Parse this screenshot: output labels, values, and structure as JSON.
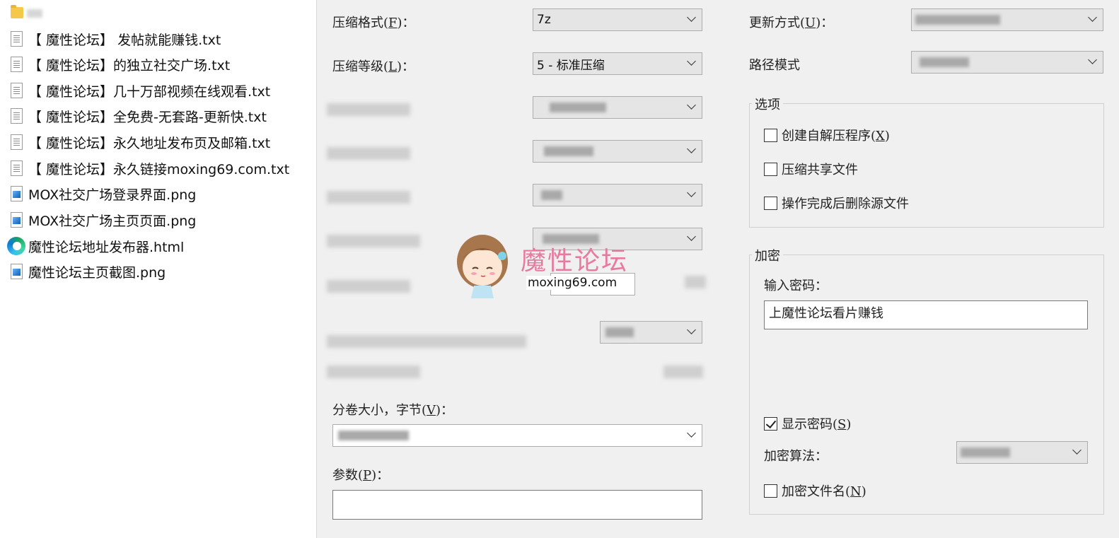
{
  "file_list": {
    "folder_label": "",
    "files": [
      {
        "name": "【 魔性论坛】 发帖就能赚钱.txt",
        "icon": "text-file-icon"
      },
      {
        "name": "【 魔性论坛】的独立社交广场.txt",
        "icon": "text-file-icon"
      },
      {
        "name": "【 魔性论坛】几十万部视频在线观看.txt",
        "icon": "text-file-icon"
      },
      {
        "name": "【 魔性论坛】全免费-无套路-更新快.txt",
        "icon": "text-file-icon"
      },
      {
        "name": "【 魔性论坛】永久地址发布页及邮箱.txt",
        "icon": "text-file-icon"
      },
      {
        "name": "【 魔性论坛】永久链接moxing69.com.txt",
        "icon": "text-file-icon"
      },
      {
        "name": "MOX社交广场登录界面.png",
        "icon": "image-file-icon"
      },
      {
        "name": "MOX社交广场主页页面.png",
        "icon": "image-file-icon"
      },
      {
        "name": "魔性论坛地址发布器.html",
        "icon": "edge-browser-icon"
      },
      {
        "name": "魔性论坛主页截图.png",
        "icon": "image-file-icon"
      }
    ]
  },
  "dialog": {
    "format_label_prefix": "压缩格式(",
    "format_label_key": "F",
    "format_label_suffix": ")：",
    "format_value": "7z",
    "level_label_prefix": "压缩等级(",
    "level_label_key": "L",
    "level_label_suffix": ")：",
    "level_value": "5 - 标准压缩",
    "volume_label_prefix": "分卷大小，字节(",
    "volume_label_key": "V",
    "volume_label_suffix": ")：",
    "params_label_prefix": "参数(",
    "params_label_key": "P",
    "params_label_suffix": ")：",
    "params_value": "",
    "update_label_prefix": "更新方式(",
    "update_label_key": "U",
    "update_label_suffix": ")：",
    "path_mode_label": "路径模式",
    "options": {
      "title": "选项",
      "sfx_prefix": "创建自解压程序(",
      "sfx_key": "X",
      "sfx_suffix": ")",
      "sfx_checked": false,
      "shared_label": "压缩共享文件",
      "shared_checked": false,
      "delete_label": "操作完成后删除源文件",
      "delete_checked": false
    },
    "encryption": {
      "title": "加密",
      "password_label": "输入密码：",
      "password_value": "上魔性论坛看片赚钱",
      "show_password_prefix": "显示密码(",
      "show_password_key": "S",
      "show_password_suffix": ")",
      "show_password_checked": true,
      "method_label": "加密算法：",
      "encrypt_names_prefix": "加密文件名(",
      "encrypt_names_key": "N",
      "encrypt_names_suffix": ")",
      "encrypt_names_checked": false
    }
  },
  "watermark": {
    "title": "魔性论坛",
    "url": "moxing69.com"
  }
}
